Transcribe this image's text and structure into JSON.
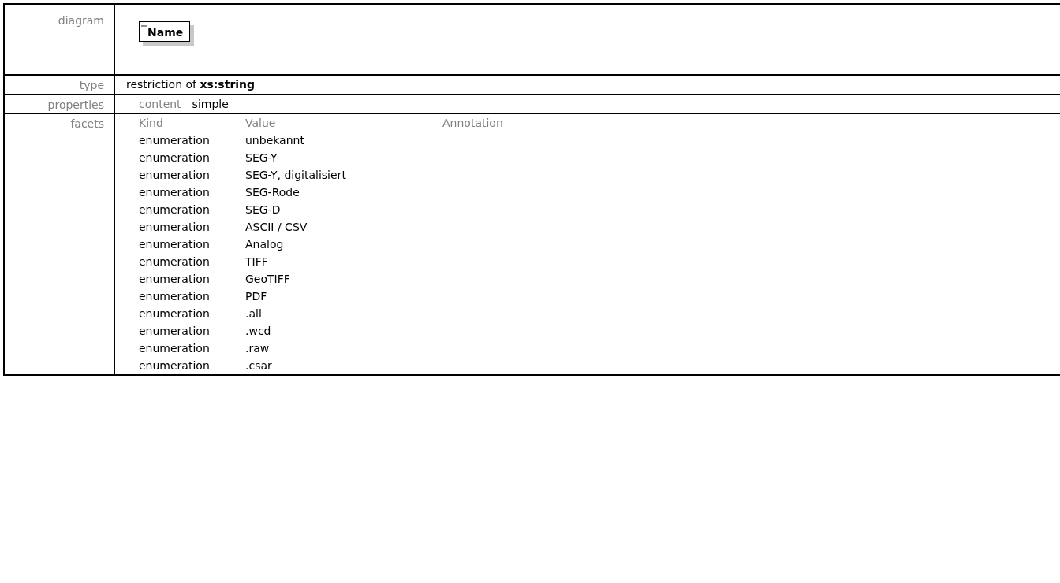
{
  "rows": [
    {
      "label": "diagram",
      "kind": "diagram",
      "element": "Name"
    },
    {
      "label": "type",
      "kind": "type",
      "prefix": "restriction of",
      "base": "xs:string"
    },
    {
      "label": "properties",
      "kind": "properties",
      "items": [
        {
          "key": "content",
          "value": "simple"
        }
      ]
    },
    {
      "label": "facets",
      "kind": "facets",
      "columns": [
        "Kind",
        "Value",
        "Annotation"
      ],
      "facets": [
        {
          "kind": "enumeration",
          "value": "unbekannt"
        },
        {
          "kind": "enumeration",
          "value": "SEG-Y"
        },
        {
          "kind": "enumeration",
          "value": "SEG-Y, digitalisiert"
        },
        {
          "kind": "enumeration",
          "value": "SEG-Rode"
        },
        {
          "kind": "enumeration",
          "value": "SEG-D"
        },
        {
          "kind": "enumeration",
          "value": "ASCII / CSV"
        },
        {
          "kind": "enumeration",
          "value": "Analog"
        },
        {
          "kind": "enumeration",
          "value": "TIFF"
        },
        {
          "kind": "enumeration",
          "value": "GeoTIFF"
        },
        {
          "kind": "enumeration",
          "value": "PDF"
        },
        {
          "kind": "enumeration",
          "value": ".all"
        },
        {
          "kind": "enumeration",
          "value": ".wcd"
        },
        {
          "kind": "enumeration",
          "value": ".raw"
        },
        {
          "kind": "enumeration",
          "value": ".csar"
        }
      ]
    }
  ]
}
